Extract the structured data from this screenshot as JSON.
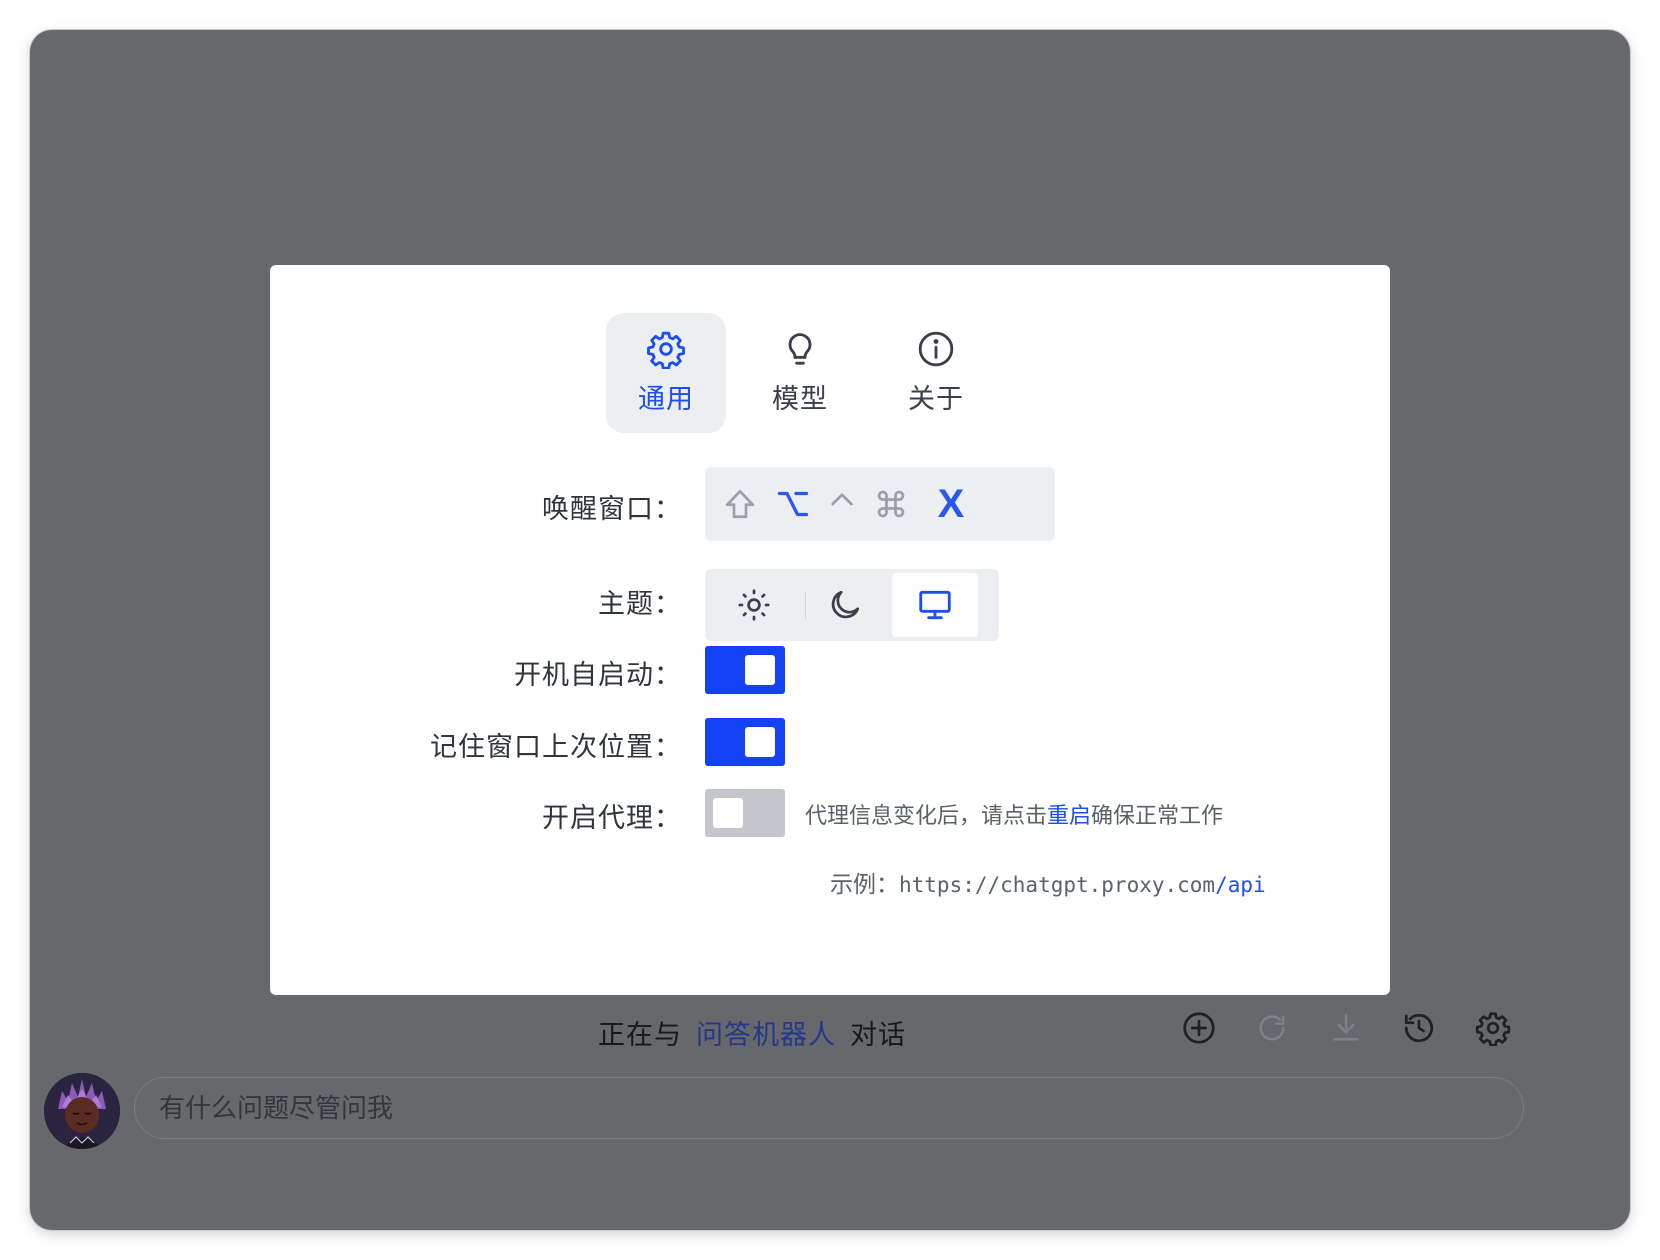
{
  "settings": {
    "tabs": [
      {
        "label": "通用",
        "icon": "gear-icon",
        "active": true
      },
      {
        "label": "模型",
        "icon": "lightbulb-icon",
        "active": false
      },
      {
        "label": "关于",
        "icon": "info-icon",
        "active": false
      }
    ],
    "wake_window": {
      "label": "唤醒窗口：",
      "keys": [
        "shift-key-icon",
        "option-key-icon",
        "control-key-icon",
        "command-key-icon"
      ],
      "key_letter": "X"
    },
    "theme": {
      "label": "主题：",
      "options": [
        "sun-icon",
        "moon-icon",
        "monitor-icon"
      ],
      "selected": "system"
    },
    "autostart": {
      "label": "开机自启动：",
      "enabled": true
    },
    "remember_position": {
      "label": "记住窗口上次位置：",
      "enabled": true
    },
    "proxy": {
      "label": "开启代理：",
      "enabled": false,
      "hint_prefix": "代理信息变化后，请点击",
      "hint_link": "重启",
      "hint_suffix": "确保正常工作",
      "example_label": "示例：",
      "example_url": "https://chatgpt.proxy.com",
      "example_path": "/api"
    }
  },
  "chat": {
    "status_prefix": "正在与",
    "bot_name": "问答机器人",
    "status_suffix": "对话",
    "toolbar": [
      "add-icon",
      "refresh-icon",
      "download-icon",
      "history-icon",
      "gear-icon"
    ],
    "input_placeholder": "有什么问题尽管问我"
  },
  "colors": {
    "accent": "#1c4ef0",
    "switch_on": "#1342f5",
    "switch_off": "#c4c6cc",
    "backdrop": "#66686c"
  }
}
